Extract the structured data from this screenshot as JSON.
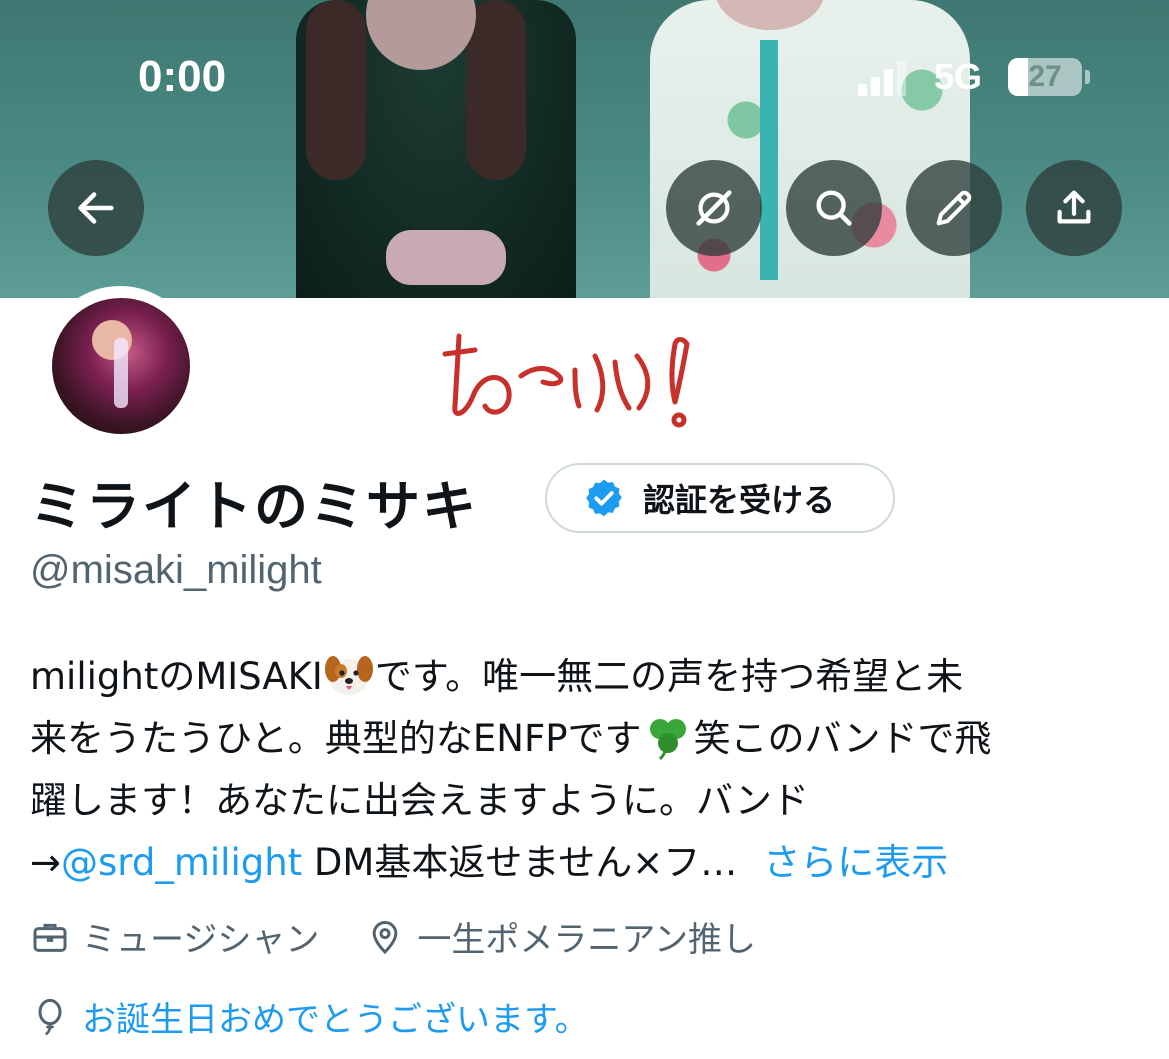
{
  "status_bar": {
    "time": "0:00",
    "network": "5G",
    "battery_percent": "27",
    "battery_level": 0.27
  },
  "header_buttons": {
    "back": "arrow-left-icon",
    "grok": "grok-icon",
    "search": "search-icon",
    "edit": "pencil-icon",
    "share": "share-icon"
  },
  "profile": {
    "display_name": "ミライトのミサキ",
    "verify_button_label": "認証を受ける",
    "handle": "@misaki_milight",
    "bio": {
      "line1_a": "milightのMISAKI",
      "line1_b": "です。唯一無二の声を持つ希望と未",
      "line2_a": "来をうたうひと。典型的なENFPです",
      "line2_b": "笑このバンドで飛",
      "line3": "躍します！あなたに出会えますように。バンド",
      "line4_prefix": "→",
      "line4_mention": "@srd_milight",
      "line4_rest": " DM基本返せません×フ…",
      "show_more": "さらに表示"
    },
    "profession": "ミュージシャン",
    "location": "一生ポメラニアン推し",
    "birthday_message": "お誕生日おめでとうございます。"
  },
  "colors": {
    "accent": "#1d9bf0",
    "secondary_text": "#536471",
    "sticker_red": "#c8302c"
  }
}
